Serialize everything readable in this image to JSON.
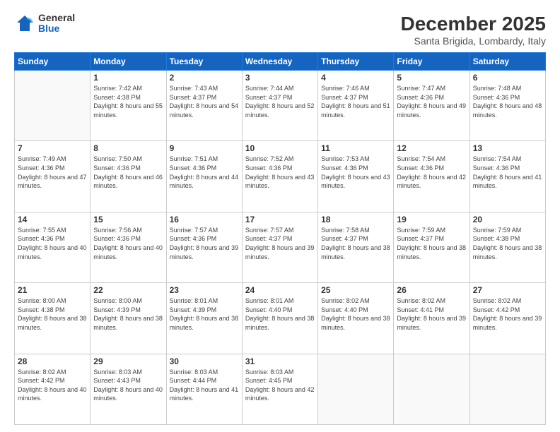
{
  "header": {
    "logo": {
      "general": "General",
      "blue": "Blue"
    },
    "title": "December 2025",
    "subtitle": "Santa Brigida, Lombardy, Italy"
  },
  "days": [
    "Sunday",
    "Monday",
    "Tuesday",
    "Wednesday",
    "Thursday",
    "Friday",
    "Saturday"
  ],
  "weeks": [
    [
      {
        "day": "",
        "empty": true
      },
      {
        "day": "1",
        "sunrise": "7:42 AM",
        "sunset": "4:38 PM",
        "daylight": "8 hours and 55 minutes."
      },
      {
        "day": "2",
        "sunrise": "7:43 AM",
        "sunset": "4:37 PM",
        "daylight": "8 hours and 54 minutes."
      },
      {
        "day": "3",
        "sunrise": "7:44 AM",
        "sunset": "4:37 PM",
        "daylight": "8 hours and 52 minutes."
      },
      {
        "day": "4",
        "sunrise": "7:46 AM",
        "sunset": "4:37 PM",
        "daylight": "8 hours and 51 minutes."
      },
      {
        "day": "5",
        "sunrise": "7:47 AM",
        "sunset": "4:36 PM",
        "daylight": "8 hours and 49 minutes."
      },
      {
        "day": "6",
        "sunrise": "7:48 AM",
        "sunset": "4:36 PM",
        "daylight": "8 hours and 48 minutes."
      }
    ],
    [
      {
        "day": "7",
        "sunrise": "7:49 AM",
        "sunset": "4:36 PM",
        "daylight": "8 hours and 47 minutes."
      },
      {
        "day": "8",
        "sunrise": "7:50 AM",
        "sunset": "4:36 PM",
        "daylight": "8 hours and 46 minutes."
      },
      {
        "day": "9",
        "sunrise": "7:51 AM",
        "sunset": "4:36 PM",
        "daylight": "8 hours and 44 minutes."
      },
      {
        "day": "10",
        "sunrise": "7:52 AM",
        "sunset": "4:36 PM",
        "daylight": "8 hours and 43 minutes."
      },
      {
        "day": "11",
        "sunrise": "7:53 AM",
        "sunset": "4:36 PM",
        "daylight": "8 hours and 43 minutes."
      },
      {
        "day": "12",
        "sunrise": "7:54 AM",
        "sunset": "4:36 PM",
        "daylight": "8 hours and 42 minutes."
      },
      {
        "day": "13",
        "sunrise": "7:54 AM",
        "sunset": "4:36 PM",
        "daylight": "8 hours and 41 minutes."
      }
    ],
    [
      {
        "day": "14",
        "sunrise": "7:55 AM",
        "sunset": "4:36 PM",
        "daylight": "8 hours and 40 minutes."
      },
      {
        "day": "15",
        "sunrise": "7:56 AM",
        "sunset": "4:36 PM",
        "daylight": "8 hours and 40 minutes."
      },
      {
        "day": "16",
        "sunrise": "7:57 AM",
        "sunset": "4:36 PM",
        "daylight": "8 hours and 39 minutes."
      },
      {
        "day": "17",
        "sunrise": "7:57 AM",
        "sunset": "4:37 PM",
        "daylight": "8 hours and 39 minutes."
      },
      {
        "day": "18",
        "sunrise": "7:58 AM",
        "sunset": "4:37 PM",
        "daylight": "8 hours and 38 minutes."
      },
      {
        "day": "19",
        "sunrise": "7:59 AM",
        "sunset": "4:37 PM",
        "daylight": "8 hours and 38 minutes."
      },
      {
        "day": "20",
        "sunrise": "7:59 AM",
        "sunset": "4:38 PM",
        "daylight": "8 hours and 38 minutes."
      }
    ],
    [
      {
        "day": "21",
        "sunrise": "8:00 AM",
        "sunset": "4:38 PM",
        "daylight": "8 hours and 38 minutes."
      },
      {
        "day": "22",
        "sunrise": "8:00 AM",
        "sunset": "4:39 PM",
        "daylight": "8 hours and 38 minutes."
      },
      {
        "day": "23",
        "sunrise": "8:01 AM",
        "sunset": "4:39 PM",
        "daylight": "8 hours and 38 minutes."
      },
      {
        "day": "24",
        "sunrise": "8:01 AM",
        "sunset": "4:40 PM",
        "daylight": "8 hours and 38 minutes."
      },
      {
        "day": "25",
        "sunrise": "8:02 AM",
        "sunset": "4:40 PM",
        "daylight": "8 hours and 38 minutes."
      },
      {
        "day": "26",
        "sunrise": "8:02 AM",
        "sunset": "4:41 PM",
        "daylight": "8 hours and 39 minutes."
      },
      {
        "day": "27",
        "sunrise": "8:02 AM",
        "sunset": "4:42 PM",
        "daylight": "8 hours and 39 minutes."
      }
    ],
    [
      {
        "day": "28",
        "sunrise": "8:02 AM",
        "sunset": "4:42 PM",
        "daylight": "8 hours and 40 minutes."
      },
      {
        "day": "29",
        "sunrise": "8:03 AM",
        "sunset": "4:43 PM",
        "daylight": "8 hours and 40 minutes."
      },
      {
        "day": "30",
        "sunrise": "8:03 AM",
        "sunset": "4:44 PM",
        "daylight": "8 hours and 41 minutes."
      },
      {
        "day": "31",
        "sunrise": "8:03 AM",
        "sunset": "4:45 PM",
        "daylight": "8 hours and 42 minutes."
      },
      {
        "day": "",
        "empty": true
      },
      {
        "day": "",
        "empty": true
      },
      {
        "day": "",
        "empty": true
      }
    ]
  ]
}
